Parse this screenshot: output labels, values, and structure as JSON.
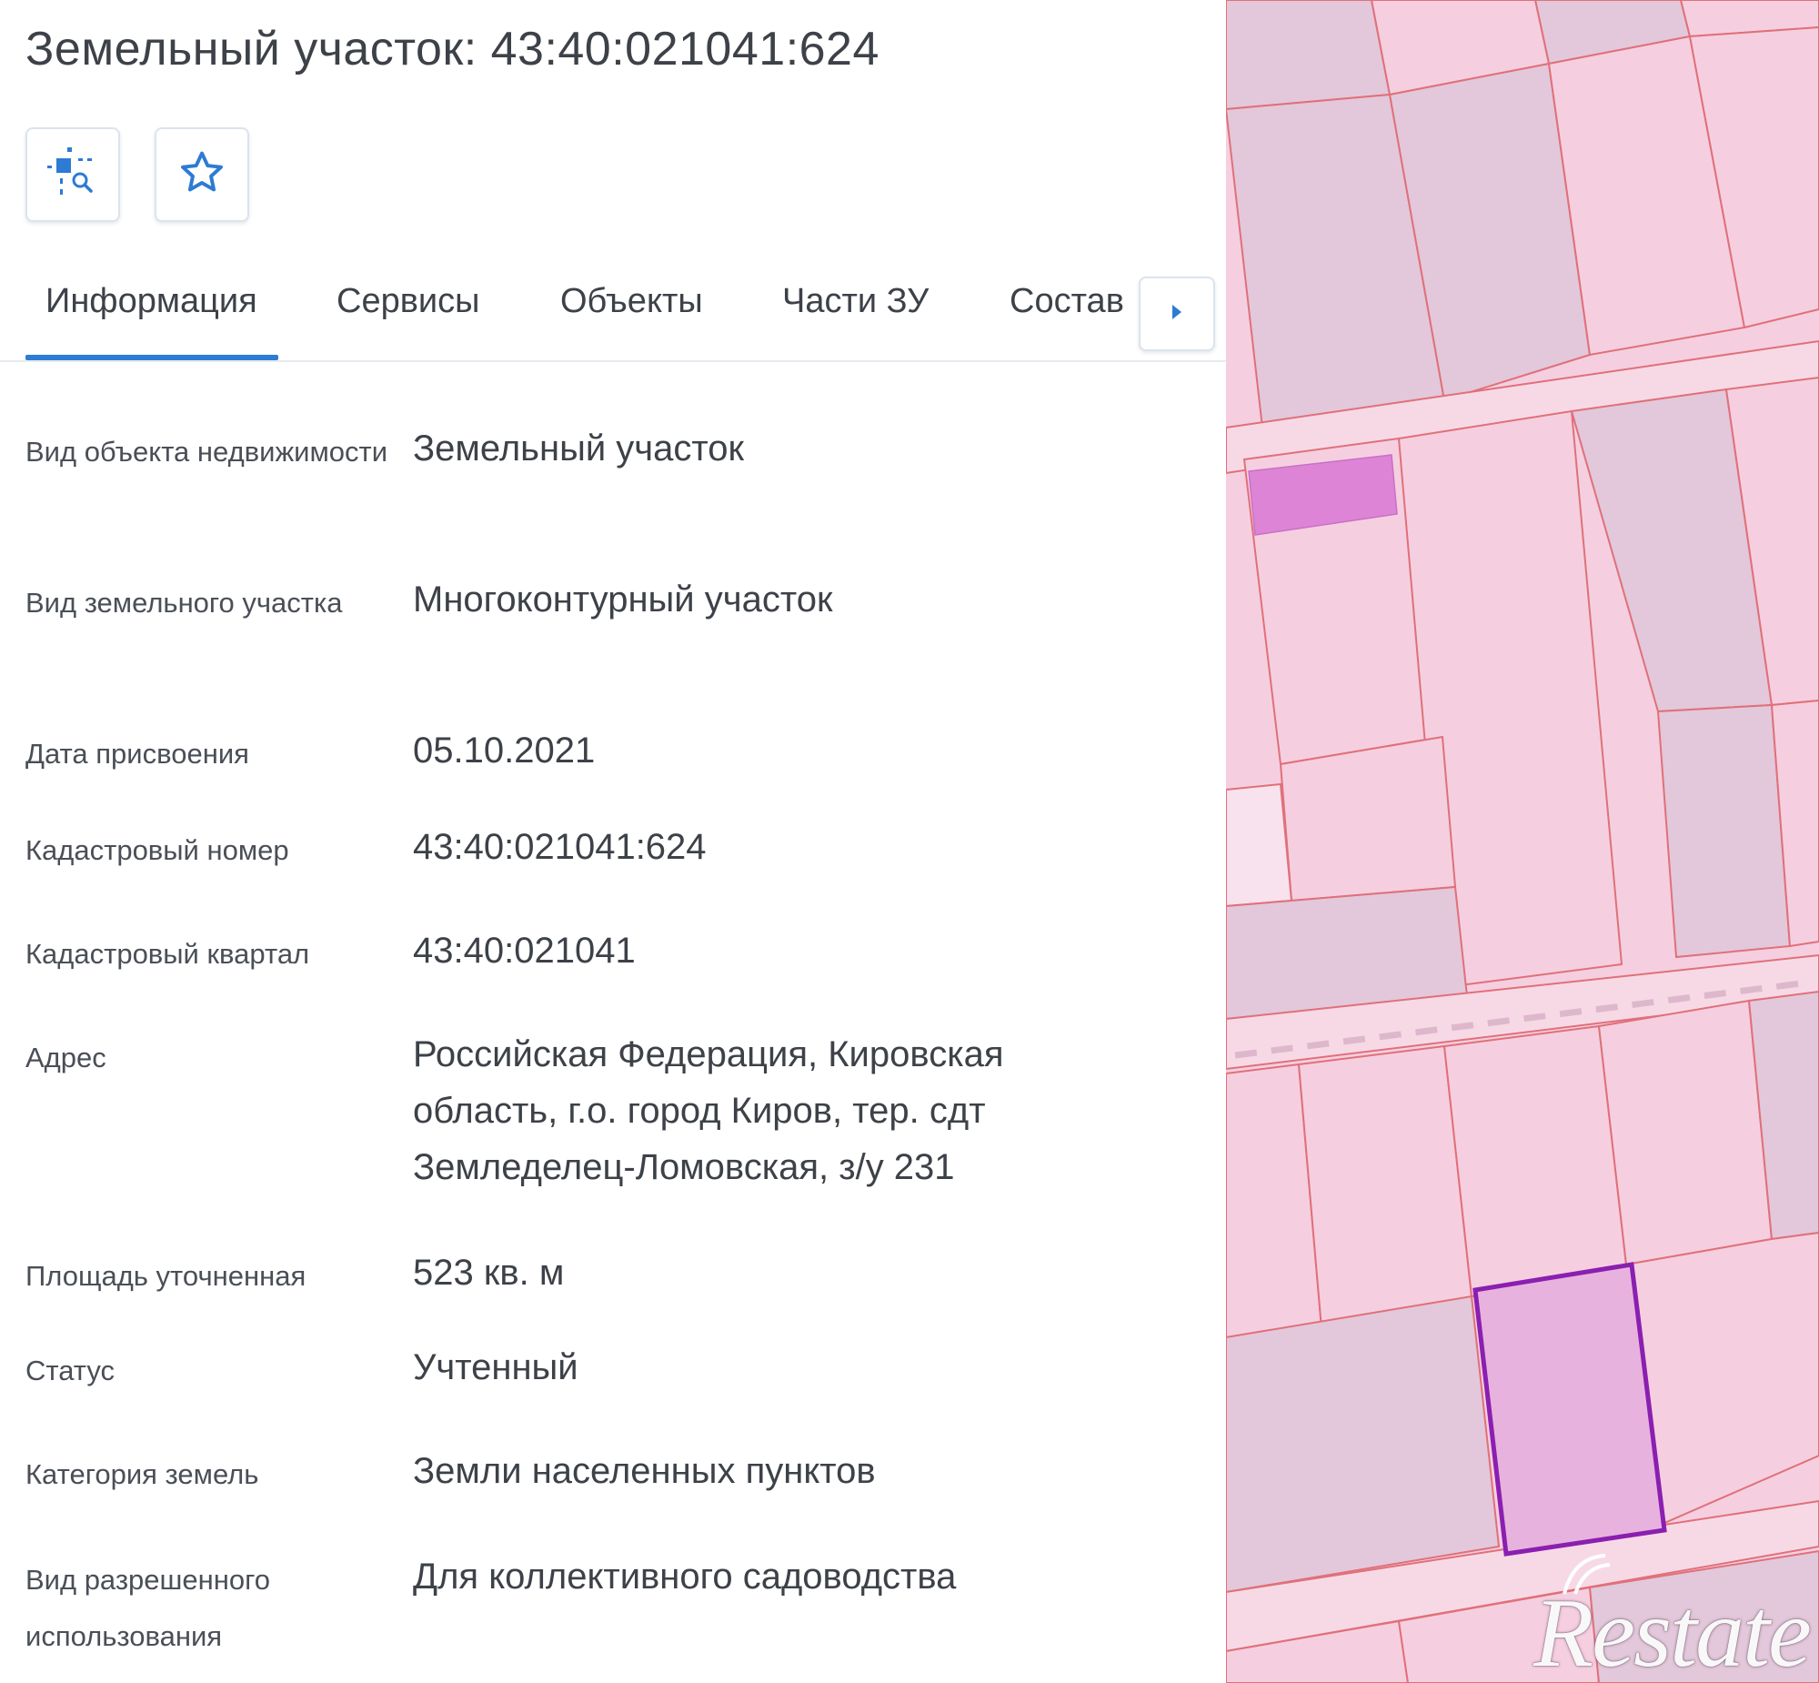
{
  "header": {
    "title": "Земельный участок: 43:40:021041:624"
  },
  "toolbar": {
    "buttons": [
      {
        "icon": "select-area-zoom-icon"
      },
      {
        "icon": "star-icon"
      }
    ]
  },
  "tabs": {
    "items": [
      {
        "label": "Информация",
        "active": true
      },
      {
        "label": "Сервисы"
      },
      {
        "label": "Объекты"
      },
      {
        "label": "Части ЗУ"
      },
      {
        "label": "Состав"
      }
    ],
    "next_icon": "chevron-right-icon"
  },
  "info": [
    {
      "label": "Вид объекта недвижимости",
      "value": "Земельный участок"
    },
    {
      "label": "Вид земельного участка",
      "value": "Многоконтурный участок"
    },
    {
      "label": "Дата присвоения",
      "value": "05.10.2021"
    },
    {
      "label": "Кадастровый номер",
      "value": "43:40:021041:624"
    },
    {
      "label": "Кадастровый квартал",
      "value": "43:40:021041"
    },
    {
      "label": "Адрес",
      "value": "Российская Федерация, Кировская область, г.о. город Киров, тер. сдт Земледелец-Ломовская, з/у 231"
    },
    {
      "label": "Площадь уточненная",
      "value": "523 кв. м"
    },
    {
      "label": "Статус",
      "value": "Учтенный"
    },
    {
      "label": "Категория земель",
      "value": "Земли населенных пунктов"
    },
    {
      "label": "Вид разрешенного использования",
      "value": "Для коллективного садоводства"
    }
  ],
  "map": {
    "watermark": "Restate",
    "colors": {
      "parcel_fill": "#f5cfe0",
      "parcel_border": "#e0707a",
      "built_fill": "#e2c8da",
      "road_fill": "#f7d9e6",
      "selected_border": "#8a1fb0",
      "highlight_fill": "#de84d6"
    }
  },
  "colors": {
    "accent": "#2d7bd3",
    "text": "#3d4148",
    "divider": "#e6ebf1"
  }
}
